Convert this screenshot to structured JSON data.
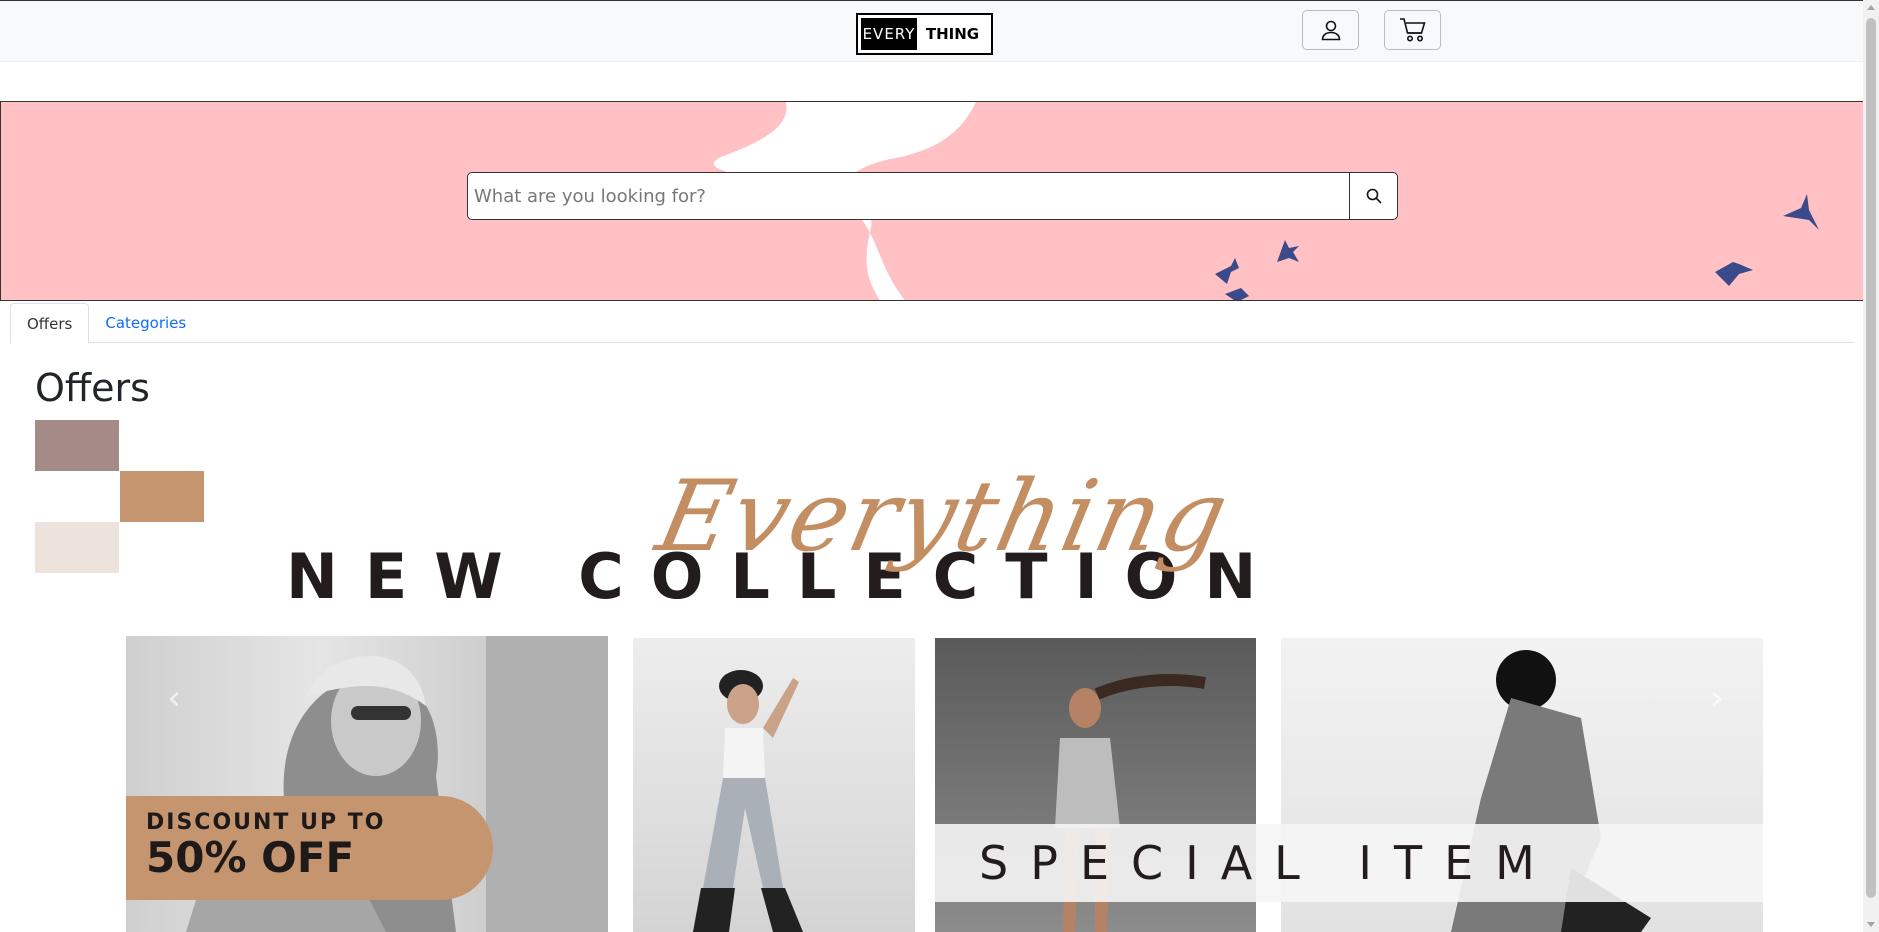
{
  "header": {
    "logo_left": "EVERY",
    "logo_right": "THING",
    "account_icon": "person-icon",
    "cart_icon": "cart-icon"
  },
  "hero": {
    "background_color": "#ffc1c3",
    "search": {
      "placeholder": "What are you looking for?",
      "value": "",
      "icon": "search-icon"
    }
  },
  "tabs": [
    {
      "label": "Offers",
      "active": true
    },
    {
      "label": "Categories",
      "active": false
    }
  ],
  "offers": {
    "title": "Offers",
    "banner": {
      "script_text": "Everything",
      "headline": "NEW COLLECTION",
      "discount_small": "DISCOUNT UP TO",
      "discount_big": "50% OFF",
      "special": "SPECIAL ITEM",
      "swatch_colors": [
        "#a58b88",
        "#c4956f",
        "#eee3dc"
      ],
      "prev_label": "‹",
      "next_label": "›"
    }
  }
}
